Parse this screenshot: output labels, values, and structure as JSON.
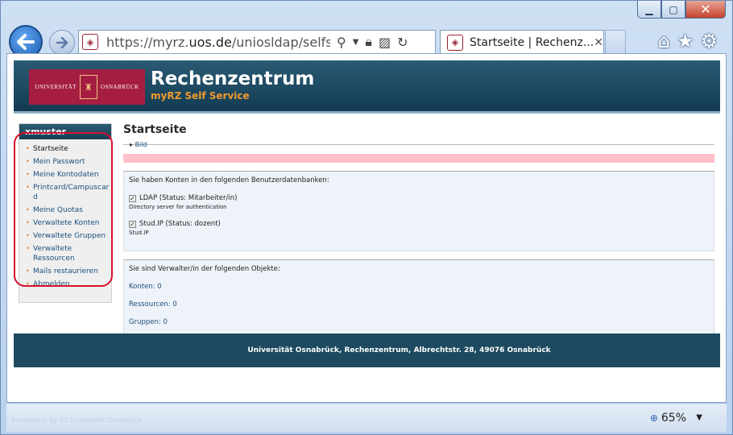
{
  "browser": {
    "window_buttons": {
      "minimize": "▁",
      "maximize": "▢",
      "close": "✕"
    },
    "url_prefix": "https://myrz.",
    "url_domain": "uos.de",
    "url_path": "/uniosldap/selfservice/",
    "tab_title": "Startseite | Rechenz...",
    "tab_close": "✕",
    "zoom_level": "65%",
    "status_text": "Screenshot by RZ Universität Osnabrück"
  },
  "site": {
    "logo_left": "UNIVERSITÄT",
    "logo_right": "OSNABRÜCK",
    "title": "Rechenzentrum",
    "subtitle": "myRZ Self Service",
    "footer": "Universität Osnabrück, Rechenzentrum, Albrechtstr. 28, 49076 Osnabrück"
  },
  "sidebar": {
    "username": "xmuster",
    "items": [
      {
        "label": "Startseite"
      },
      {
        "label": "Mein Passwort"
      },
      {
        "label": "Meine Kontodaten"
      },
      {
        "label": "Printcard/Campuscard"
      },
      {
        "label": "Meine Quotas"
      },
      {
        "label": "Verwaltete Konten"
      },
      {
        "label": "Verwaltete Gruppen"
      },
      {
        "label": "Verwaltete Ressourcen"
      },
      {
        "label": "Mails restaurieren"
      },
      {
        "label": "Abmelden"
      }
    ]
  },
  "main": {
    "title": "Startseite",
    "bild_label": "Bild",
    "accounts_intro": "Sie haben Konten in den folgenden Benutzerdatenbanken:",
    "accounts": [
      {
        "label": "LDAP (Status: Mitarbeiter/in)",
        "desc": "Directory server for authentication"
      },
      {
        "label": "Stud.IP (Status: dozent)",
        "desc": "Stud.IP"
      }
    ],
    "objects_intro": "Sie sind Verwalter/in der folgenden Objekte:",
    "objects": [
      {
        "label": "Konten: 0"
      },
      {
        "label": "Ressourcen: 0"
      },
      {
        "label": "Gruppen: 0"
      }
    ]
  },
  "colors": {
    "header": "#1e4b62",
    "accent_orange": "#f39a2c",
    "logo_red": "#a51e42",
    "annotation_red": "#d8102a"
  }
}
